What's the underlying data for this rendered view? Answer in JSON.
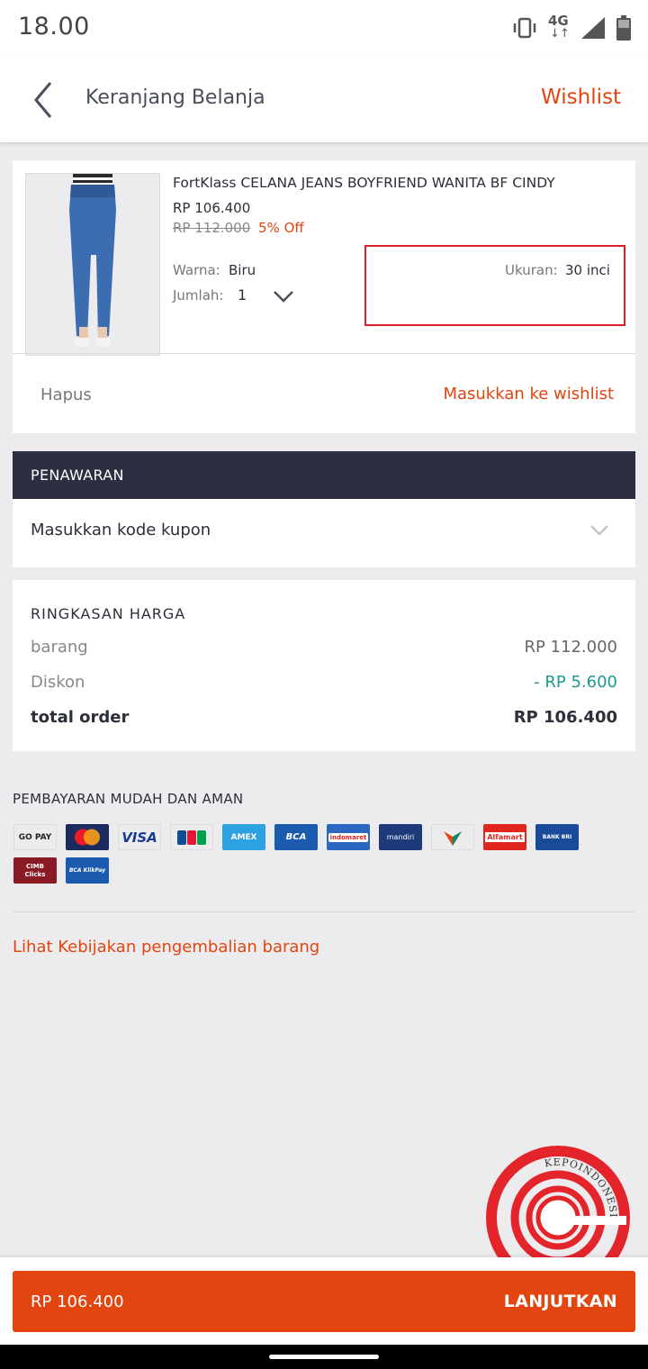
{
  "status_bar": {
    "time": "18.00",
    "network": "4G",
    "icons": [
      "vibrate-icon",
      "network-4g-icon",
      "signal-icon",
      "battery-icon"
    ]
  },
  "header": {
    "title": "Keranjang Belanja",
    "wishlist_label": "Wishlist",
    "back_icon": "chevron-left-icon"
  },
  "product": {
    "name": "FortKlass CELANA JEANS BOYFRIEND WANITA BF CINDY",
    "price": "RP 106.400",
    "old_price": "RP 112.000",
    "discount": "5% Off",
    "color_label": "Warna:",
    "color_value": "Biru",
    "qty_label": "Jumlah:",
    "qty_value": "1",
    "size_label": "Ukuran:",
    "size_value": "30 inci",
    "delete_label": "Hapus",
    "move_wishlist_label": "Masukkan ke wishlist"
  },
  "promo": {
    "header": "PENAWARAN",
    "coupon_placeholder": "Masukkan kode kupon"
  },
  "summary": {
    "title": "RINGKASAN HARGA",
    "rows": [
      {
        "label": "barang",
        "value": "RP 112.000"
      },
      {
        "label": "Diskon",
        "value": "- RP 5.600"
      },
      {
        "label": "total order",
        "value": "RP 106.400"
      }
    ]
  },
  "payment": {
    "title": "PEMBAYARAN MUDAH DAN AMAN",
    "methods": [
      {
        "name": "GO-PAY",
        "label": "GO PAY",
        "bg": "#ffffff",
        "fg": "#222222"
      },
      {
        "name": "Mastercard",
        "label": "",
        "bg": "#1b2b5e",
        "fg": "#ffffff"
      },
      {
        "name": "Visa",
        "label": "VISA",
        "bg": "#ffffff",
        "fg": "#1a3a9a"
      },
      {
        "name": "JCB",
        "label": "",
        "bg": "#ffffff",
        "fg": "#222222"
      },
      {
        "name": "AMEX",
        "label": "AMEX",
        "bg": "#2ea1e0",
        "fg": "#ffffff"
      },
      {
        "name": "BCA",
        "label": "BCA",
        "bg": "#1a5bb0",
        "fg": "#ffffff"
      },
      {
        "name": "Indomaret",
        "label": "indomaret",
        "bg": "#2a67c1",
        "fg": "#ffffff"
      },
      {
        "name": "Mandiri",
        "label": "mandiri",
        "bg": "#1e3a7a",
        "fg": "#ffffff"
      },
      {
        "name": "BNI",
        "label": "",
        "bg": "#ffffff",
        "fg": "#222222"
      },
      {
        "name": "Alfamart",
        "label": "Alfamart",
        "bg": "#e0261d",
        "fg": "#ffffff"
      },
      {
        "name": "BRI",
        "label": "BANK BRI",
        "bg": "#1a4a9a",
        "fg": "#ffffff"
      },
      {
        "name": "CIMB Clicks",
        "label": "CIMB Clicks",
        "bg": "#8a1a24",
        "fg": "#ffffff"
      },
      {
        "name": "BCA KlikPay",
        "label": "BCA KlikPay",
        "bg": "#1a5bb0",
        "fg": "#ffffff"
      }
    ]
  },
  "policy_link": "Lihat Kebijakan pengembalian barang",
  "watermark": "KEPOINDONESIA",
  "checkout": {
    "total": "RP 106.400",
    "button": "LANJUTKAN"
  },
  "colors": {
    "accent": "#e2450f",
    "dark_header": "#2c2f42",
    "discount_green": "#1d9a8e",
    "highlight_red": "#d8202a"
  }
}
